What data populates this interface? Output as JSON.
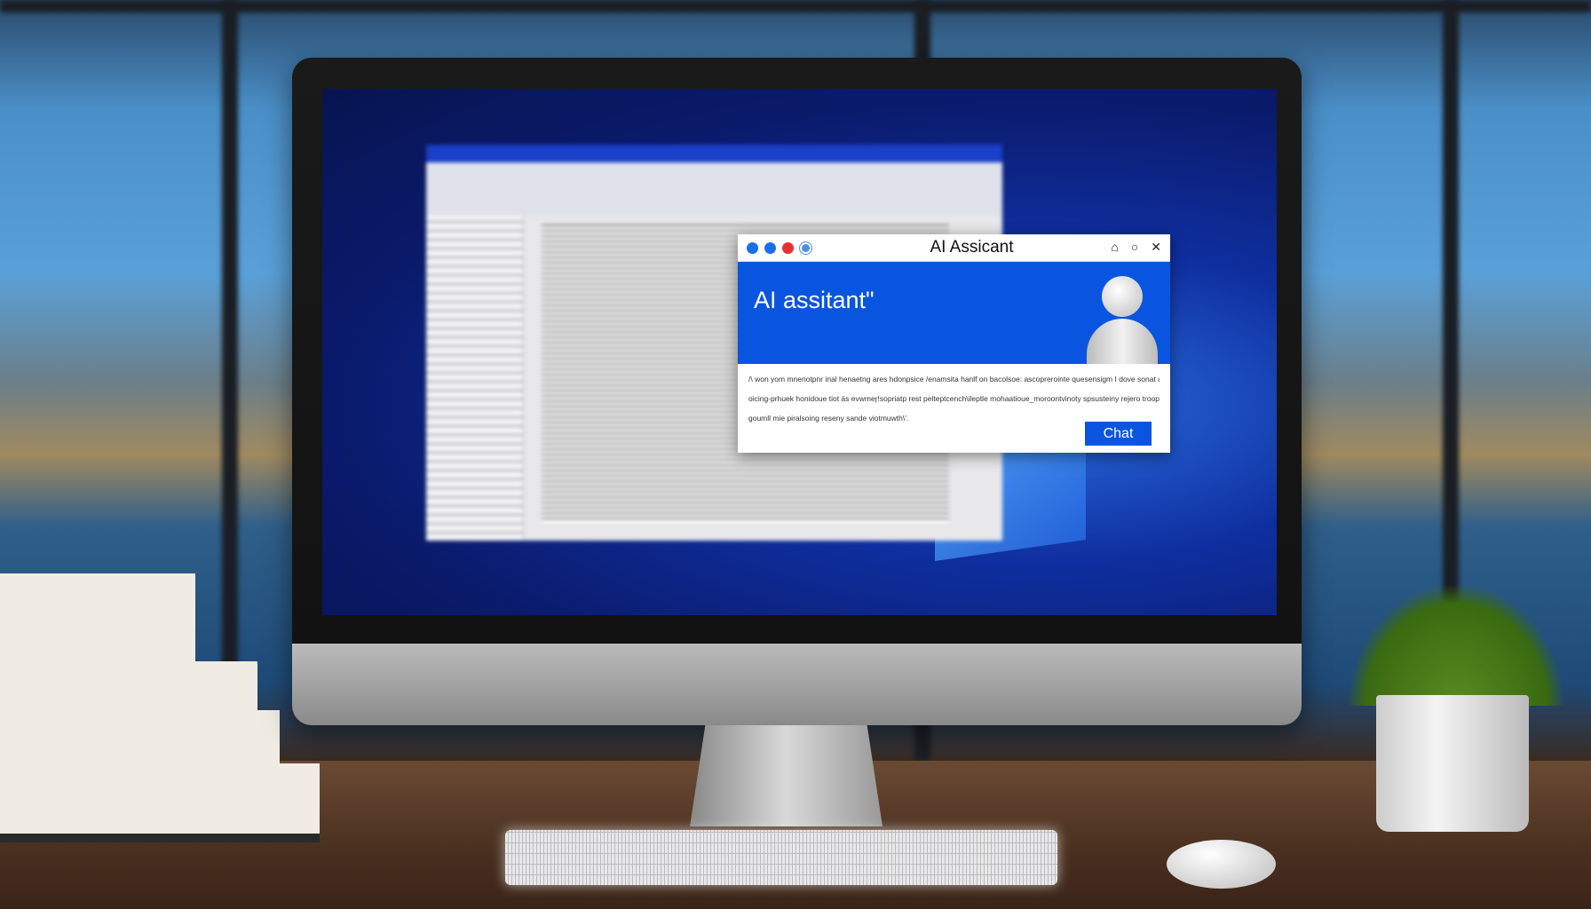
{
  "dialog": {
    "title": "AI Assicant",
    "hero_title": "AI assitant\"",
    "body_lines": [
      "/\\ won yom mnenotpnr inal henaetng ares hdonpsice /enamsita hanlf on bacolsoe: ascoprerointe quesensigm I dove sonat a veel al mwenats",
      "oicing-prhuek honidoue tiot äs evwmeɼ!sopriatp rest pelteptcench\\ileptle mohaatioue_moroontvinoty spsusteiny rejero troopor wren",
      "goumll mie piralsoing reseny sande viotmuwth\\'."
    ],
    "chat_button": "Chat",
    "traffic_dot_colors": [
      "#1a6fe8",
      "#1a6fe8",
      "#e83030",
      "#4a90e8"
    ],
    "controls": [
      "bell-icon",
      "circle-icon",
      "close-icon"
    ],
    "accent": "#0a55e0"
  }
}
